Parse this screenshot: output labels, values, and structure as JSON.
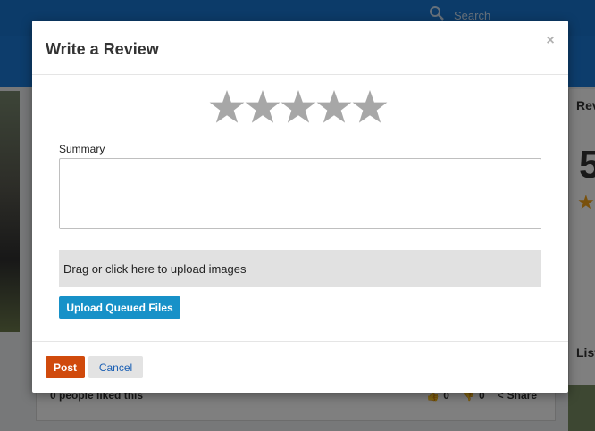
{
  "background": {
    "search_placeholder": "Search",
    "right_col_title": "Rev",
    "right_col_rating": "5",
    "right_col_title2": "List",
    "likes_text": "0 people liked this",
    "thumbs_up_count": "0",
    "thumbs_down_count": "0",
    "share_label": "Share"
  },
  "modal": {
    "title": "Write a Review",
    "close_glyph": "×",
    "rating": {
      "max": 5,
      "selected": 0,
      "empty_color": "#a7a7a7"
    },
    "summary_label": "Summary",
    "summary_value": "",
    "dropzone_text": "Drag or click here to upload images",
    "upload_button": "Upload Queued Files",
    "post_button": "Post",
    "cancel_button": "Cancel"
  },
  "colors": {
    "topbar": "#1976d2",
    "upload_button": "#1791c8",
    "post_button": "#d04a0c",
    "cancel_text": "#1a5fb4",
    "star_accent": "#f3a31b"
  }
}
